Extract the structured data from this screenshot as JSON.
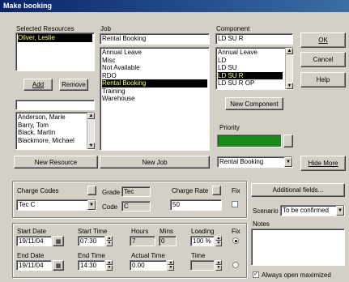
{
  "window": {
    "title": "Make booking"
  },
  "selected_resources": {
    "label": "Selected Resources",
    "items": [
      "Oliver, Leslie"
    ]
  },
  "resource_buttons": {
    "add": "Add",
    "remove": "Remove"
  },
  "resource_search": {
    "value": ""
  },
  "resource_list": {
    "items": [
      "Anderson, Marie",
      "Barry, Tom",
      "Black, Martin",
      "Blackmore, Michael"
    ]
  },
  "new_resource_button": "New Resource",
  "job": {
    "label": "Job",
    "value": "Rental Booking",
    "items": [
      "Annual Leave",
      "Misc",
      "Not Available",
      "RDO",
      "Rental Booking",
      "Training",
      "Warehouse"
    ],
    "selected_index": 4
  },
  "new_job_button": "New Job",
  "component": {
    "label": "Component",
    "value": "LD SU R",
    "items": [
      "Annual Leave",
      "LD",
      "LD SU",
      "LD SU R",
      "LD SU R OP"
    ],
    "selected_index": 3
  },
  "new_component_button": "New Component",
  "priority": {
    "label": "Priority",
    "color": "#1a8a1a"
  },
  "priority_select": {
    "value": "Rental Booking"
  },
  "buttons": {
    "ok": "OK",
    "cancel": "Cancel",
    "help": "Help",
    "hide_more": "Hide More",
    "additional_fields": "Additional fields..."
  },
  "charge": {
    "codes_label": "Charge Codes",
    "codes_value": "Tec C",
    "grade_label": "Grade",
    "grade_value": "Tec",
    "code_label": "Code",
    "code_value": "C",
    "rate_label": "Charge Rate",
    "rate_value": "50",
    "fix_label": "Fix"
  },
  "scenario": {
    "label": "Scenario",
    "value": "To be confirmed"
  },
  "notes": {
    "label": "Notes",
    "value": ""
  },
  "times": {
    "start_date_label": "Start Date",
    "start_date": "19/11/04",
    "start_time_label": "Start Time",
    "start_time": "07:30",
    "end_date_label": "End Date",
    "end_date": "19/11/04",
    "end_time_label": "End Time",
    "end_time": "14:30",
    "hours_label": "Hours",
    "hours": "7",
    "mins_label": "Mins",
    "mins": "0",
    "actual_time_label": "Actual Time",
    "actual_time": "0.00",
    "loading_label": "Loading",
    "loading": "100 %",
    "time_label": "Time",
    "time": "",
    "fix_label": "Fix"
  },
  "always_open_maximized": {
    "label": "Always open maximized",
    "checked": true
  },
  "colors": {
    "title_start": "#0a246a",
    "title_end": "#3a6ea5",
    "face": "#d4d0c8",
    "selection": "#000000",
    "selection_text": "#ffff80"
  }
}
